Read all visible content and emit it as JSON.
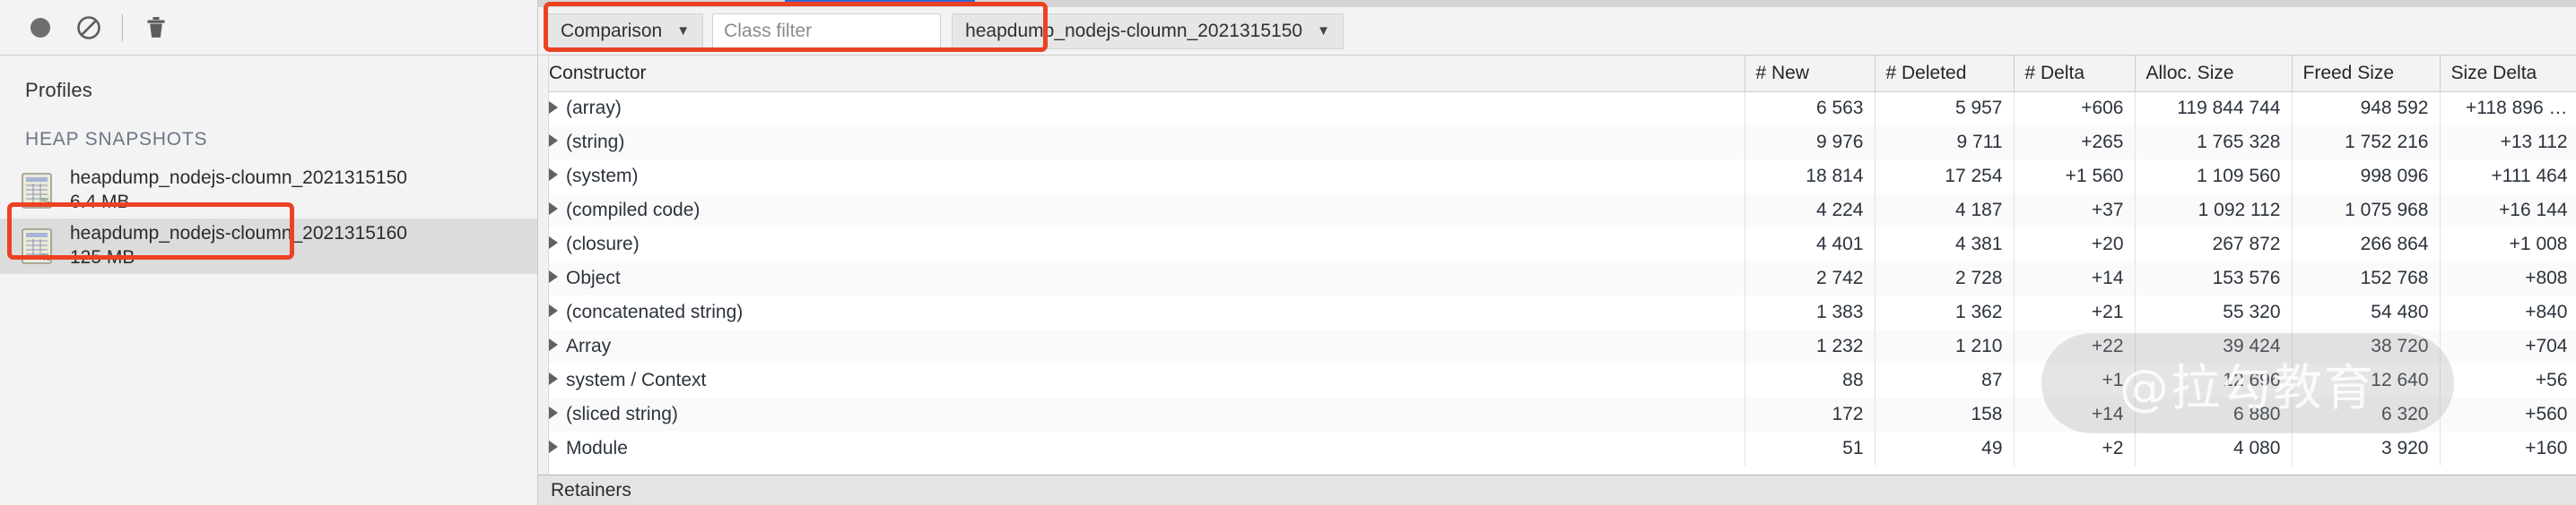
{
  "left_panel": {
    "toolbar": {
      "record_label": "record-circle",
      "clear_label": "clear-no-entry",
      "delete_label": "trash"
    },
    "profiles_title": "Profiles",
    "section_title": "HEAP SNAPSHOTS",
    "snapshots": [
      {
        "name": "heapdump_nodejs-cloumn_2021315150",
        "size": "6.4 MB",
        "selected": false
      },
      {
        "name": "heapdump_nodejs-cloumn_2021315160",
        "size": "125 MB",
        "selected": true
      }
    ]
  },
  "filter_bar": {
    "view_mode": "Comparison",
    "view_mode_caret": "▼",
    "class_filter_placeholder": "Class filter",
    "class_filter_value": "",
    "baseline_snapshot": "heapdump_nodejs-cloumn_2021315150",
    "baseline_caret": "▼"
  },
  "highlight_color": "#ec4123",
  "accent_color": "#3367d6",
  "table": {
    "columns": [
      "Constructor",
      "# New",
      "# Deleted",
      "# Delta",
      "Alloc. Size",
      "Freed Size",
      "Size Delta"
    ],
    "rows": [
      {
        "constructor": "(array)",
        "new": "6 563",
        "deleted": "5 957",
        "delta": "+606",
        "alloc": "119 844 744",
        "freed": "948 592",
        "size_delta": "+118 896 …"
      },
      {
        "constructor": "(string)",
        "new": "9 976",
        "deleted": "9 711",
        "delta": "+265",
        "alloc": "1 765 328",
        "freed": "1 752 216",
        "size_delta": "+13 112"
      },
      {
        "constructor": "(system)",
        "new": "18 814",
        "deleted": "17 254",
        "delta": "+1 560",
        "alloc": "1 109 560",
        "freed": "998 096",
        "size_delta": "+111 464"
      },
      {
        "constructor": "(compiled code)",
        "new": "4 224",
        "deleted": "4 187",
        "delta": "+37",
        "alloc": "1 092 112",
        "freed": "1 075 968",
        "size_delta": "+16 144"
      },
      {
        "constructor": "(closure)",
        "new": "4 401",
        "deleted": "4 381",
        "delta": "+20",
        "alloc": "267 872",
        "freed": "266 864",
        "size_delta": "+1 008"
      },
      {
        "constructor": "Object",
        "new": "2 742",
        "deleted": "2 728",
        "delta": "+14",
        "alloc": "153 576",
        "freed": "152 768",
        "size_delta": "+808"
      },
      {
        "constructor": "(concatenated string)",
        "new": "1 383",
        "deleted": "1 362",
        "delta": "+21",
        "alloc": "55 320",
        "freed": "54 480",
        "size_delta": "+840"
      },
      {
        "constructor": "Array",
        "new": "1 232",
        "deleted": "1 210",
        "delta": "+22",
        "alloc": "39 424",
        "freed": "38 720",
        "size_delta": "+704"
      },
      {
        "constructor": "system / Context",
        "new": "88",
        "deleted": "87",
        "delta": "+1",
        "alloc": "12 696",
        "freed": "12 640",
        "size_delta": "+56"
      },
      {
        "constructor": "(sliced string)",
        "new": "172",
        "deleted": "158",
        "delta": "+14",
        "alloc": "6 880",
        "freed": "6 320",
        "size_delta": "+560"
      },
      {
        "constructor": "Module",
        "new": "51",
        "deleted": "49",
        "delta": "+2",
        "alloc": "4 080",
        "freed": "3 920",
        "size_delta": "+160"
      }
    ]
  },
  "retainers_label": "Retainers",
  "watermark": "@拉勾教育"
}
